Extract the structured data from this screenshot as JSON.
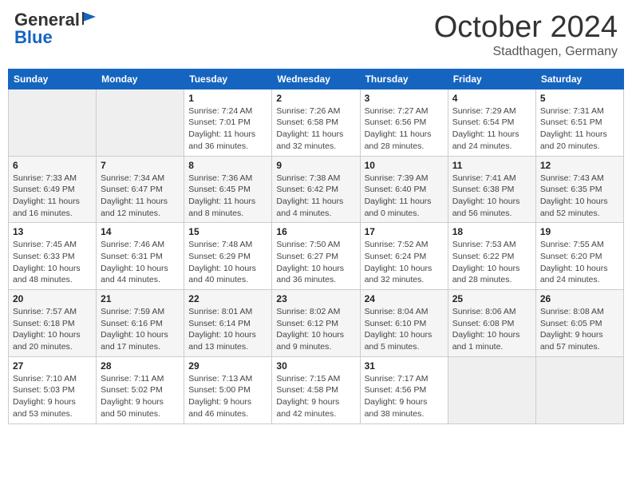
{
  "header": {
    "logo_general": "General",
    "logo_blue": "Blue",
    "month": "October 2024",
    "location": "Stadthagen, Germany"
  },
  "days_of_week": [
    "Sunday",
    "Monday",
    "Tuesday",
    "Wednesday",
    "Thursday",
    "Friday",
    "Saturday"
  ],
  "weeks": [
    [
      {
        "day": "",
        "info": ""
      },
      {
        "day": "",
        "info": ""
      },
      {
        "day": "1",
        "info": "Sunrise: 7:24 AM\nSunset: 7:01 PM\nDaylight: 11 hours and 36 minutes."
      },
      {
        "day": "2",
        "info": "Sunrise: 7:26 AM\nSunset: 6:58 PM\nDaylight: 11 hours and 32 minutes."
      },
      {
        "day": "3",
        "info": "Sunrise: 7:27 AM\nSunset: 6:56 PM\nDaylight: 11 hours and 28 minutes."
      },
      {
        "day": "4",
        "info": "Sunrise: 7:29 AM\nSunset: 6:54 PM\nDaylight: 11 hours and 24 minutes."
      },
      {
        "day": "5",
        "info": "Sunrise: 7:31 AM\nSunset: 6:51 PM\nDaylight: 11 hours and 20 minutes."
      }
    ],
    [
      {
        "day": "6",
        "info": "Sunrise: 7:33 AM\nSunset: 6:49 PM\nDaylight: 11 hours and 16 minutes."
      },
      {
        "day": "7",
        "info": "Sunrise: 7:34 AM\nSunset: 6:47 PM\nDaylight: 11 hours and 12 minutes."
      },
      {
        "day": "8",
        "info": "Sunrise: 7:36 AM\nSunset: 6:45 PM\nDaylight: 11 hours and 8 minutes."
      },
      {
        "day": "9",
        "info": "Sunrise: 7:38 AM\nSunset: 6:42 PM\nDaylight: 11 hours and 4 minutes."
      },
      {
        "day": "10",
        "info": "Sunrise: 7:39 AM\nSunset: 6:40 PM\nDaylight: 11 hours and 0 minutes."
      },
      {
        "day": "11",
        "info": "Sunrise: 7:41 AM\nSunset: 6:38 PM\nDaylight: 10 hours and 56 minutes."
      },
      {
        "day": "12",
        "info": "Sunrise: 7:43 AM\nSunset: 6:35 PM\nDaylight: 10 hours and 52 minutes."
      }
    ],
    [
      {
        "day": "13",
        "info": "Sunrise: 7:45 AM\nSunset: 6:33 PM\nDaylight: 10 hours and 48 minutes."
      },
      {
        "day": "14",
        "info": "Sunrise: 7:46 AM\nSunset: 6:31 PM\nDaylight: 10 hours and 44 minutes."
      },
      {
        "day": "15",
        "info": "Sunrise: 7:48 AM\nSunset: 6:29 PM\nDaylight: 10 hours and 40 minutes."
      },
      {
        "day": "16",
        "info": "Sunrise: 7:50 AM\nSunset: 6:27 PM\nDaylight: 10 hours and 36 minutes."
      },
      {
        "day": "17",
        "info": "Sunrise: 7:52 AM\nSunset: 6:24 PM\nDaylight: 10 hours and 32 minutes."
      },
      {
        "day": "18",
        "info": "Sunrise: 7:53 AM\nSunset: 6:22 PM\nDaylight: 10 hours and 28 minutes."
      },
      {
        "day": "19",
        "info": "Sunrise: 7:55 AM\nSunset: 6:20 PM\nDaylight: 10 hours and 24 minutes."
      }
    ],
    [
      {
        "day": "20",
        "info": "Sunrise: 7:57 AM\nSunset: 6:18 PM\nDaylight: 10 hours and 20 minutes."
      },
      {
        "day": "21",
        "info": "Sunrise: 7:59 AM\nSunset: 6:16 PM\nDaylight: 10 hours and 17 minutes."
      },
      {
        "day": "22",
        "info": "Sunrise: 8:01 AM\nSunset: 6:14 PM\nDaylight: 10 hours and 13 minutes."
      },
      {
        "day": "23",
        "info": "Sunrise: 8:02 AM\nSunset: 6:12 PM\nDaylight: 10 hours and 9 minutes."
      },
      {
        "day": "24",
        "info": "Sunrise: 8:04 AM\nSunset: 6:10 PM\nDaylight: 10 hours and 5 minutes."
      },
      {
        "day": "25",
        "info": "Sunrise: 8:06 AM\nSunset: 6:08 PM\nDaylight: 10 hours and 1 minute."
      },
      {
        "day": "26",
        "info": "Sunrise: 8:08 AM\nSunset: 6:05 PM\nDaylight: 9 hours and 57 minutes."
      }
    ],
    [
      {
        "day": "27",
        "info": "Sunrise: 7:10 AM\nSunset: 5:03 PM\nDaylight: 9 hours and 53 minutes."
      },
      {
        "day": "28",
        "info": "Sunrise: 7:11 AM\nSunset: 5:02 PM\nDaylight: 9 hours and 50 minutes."
      },
      {
        "day": "29",
        "info": "Sunrise: 7:13 AM\nSunset: 5:00 PM\nDaylight: 9 hours and 46 minutes."
      },
      {
        "day": "30",
        "info": "Sunrise: 7:15 AM\nSunset: 4:58 PM\nDaylight: 9 hours and 42 minutes."
      },
      {
        "day": "31",
        "info": "Sunrise: 7:17 AM\nSunset: 4:56 PM\nDaylight: 9 hours and 38 minutes."
      },
      {
        "day": "",
        "info": ""
      },
      {
        "day": "",
        "info": ""
      }
    ]
  ]
}
